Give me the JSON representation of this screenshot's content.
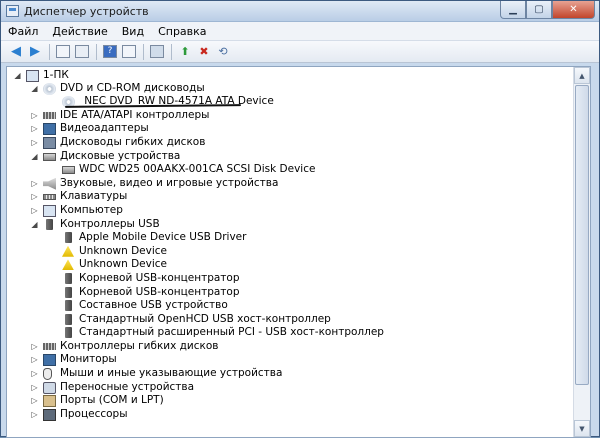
{
  "window": {
    "title": "Диспетчер устройств"
  },
  "menu": [
    "Файл",
    "Действие",
    "Вид",
    "Справка"
  ],
  "toolbar": [
    "back-icon",
    "forward-icon",
    "show-hide-console-tree-icon",
    "properties-icon",
    "help-icon",
    "view-icon",
    "scan-hardware-icon",
    "update-driver-icon",
    "uninstall-icon",
    "disable-icon"
  ],
  "tree": [
    {
      "level": 0,
      "exp": "◢",
      "icon": "computer",
      "label": "1-ПК"
    },
    {
      "level": 1,
      "exp": "◢",
      "icon": "dvd",
      "label": "DVD и CD-ROM дисководы"
    },
    {
      "level": 2,
      "exp": "",
      "icon": "dvd",
      "label": "_NEC DVD_RW ND-4571A ATA Device"
    },
    {
      "level": 1,
      "exp": "▷",
      "icon": "ide",
      "label": "IDE ATA/ATAPI контроллеры"
    },
    {
      "level": 1,
      "exp": "▷",
      "icon": "monitor",
      "label": "Видеоадаптеры"
    },
    {
      "level": 1,
      "exp": "▷",
      "icon": "floppy",
      "label": "Дисководы гибких дисков"
    },
    {
      "level": 1,
      "exp": "◢",
      "icon": "disk",
      "label": "Дисковые устройства"
    },
    {
      "level": 2,
      "exp": "",
      "icon": "disk",
      "label": "WDC WD25 00AAKX-001CA SCSI Disk Device"
    },
    {
      "level": 1,
      "exp": "▷",
      "icon": "audio",
      "label": "Звуковые, видео и игровые устройства"
    },
    {
      "level": 1,
      "exp": "▷",
      "icon": "kbd",
      "label": "Клавиатуры"
    },
    {
      "level": 1,
      "exp": "▷",
      "icon": "computer",
      "label": "Компьютер"
    },
    {
      "level": 1,
      "exp": "◢",
      "icon": "usb",
      "label": "Контроллеры USB"
    },
    {
      "level": 2,
      "exp": "",
      "icon": "usb",
      "label": "Apple Mobile Device USB Driver"
    },
    {
      "level": 2,
      "exp": "",
      "icon": "warn",
      "label": "Unknown Device"
    },
    {
      "level": 2,
      "exp": "",
      "icon": "warn",
      "label": "Unknown Device"
    },
    {
      "level": 2,
      "exp": "",
      "icon": "usb",
      "label": "Корневой USB-концентратор"
    },
    {
      "level": 2,
      "exp": "",
      "icon": "usb",
      "label": "Корневой USB-концентратор"
    },
    {
      "level": 2,
      "exp": "",
      "icon": "usb",
      "label": "Составное USB устройство"
    },
    {
      "level": 2,
      "exp": "",
      "icon": "usb",
      "label": "Стандартный OpenHCD USB хост-контроллер"
    },
    {
      "level": 2,
      "exp": "",
      "icon": "usb",
      "label": "Стандартный расширенный PCI - USB хост-контроллер"
    },
    {
      "level": 1,
      "exp": "▷",
      "icon": "ide",
      "label": "Контроллеры гибких дисков"
    },
    {
      "level": 1,
      "exp": "▷",
      "icon": "monitor",
      "label": "Мониторы"
    },
    {
      "level": 1,
      "exp": "▷",
      "icon": "mouse",
      "label": "Мыши и иные указывающие устройства"
    },
    {
      "level": 1,
      "exp": "▷",
      "icon": "portable",
      "label": "Переносные устройства"
    },
    {
      "level": 1,
      "exp": "▷",
      "icon": "port",
      "label": "Порты (COM и LPT)"
    },
    {
      "level": 1,
      "exp": "▷",
      "icon": "cpu",
      "label": "Процессоры"
    }
  ]
}
